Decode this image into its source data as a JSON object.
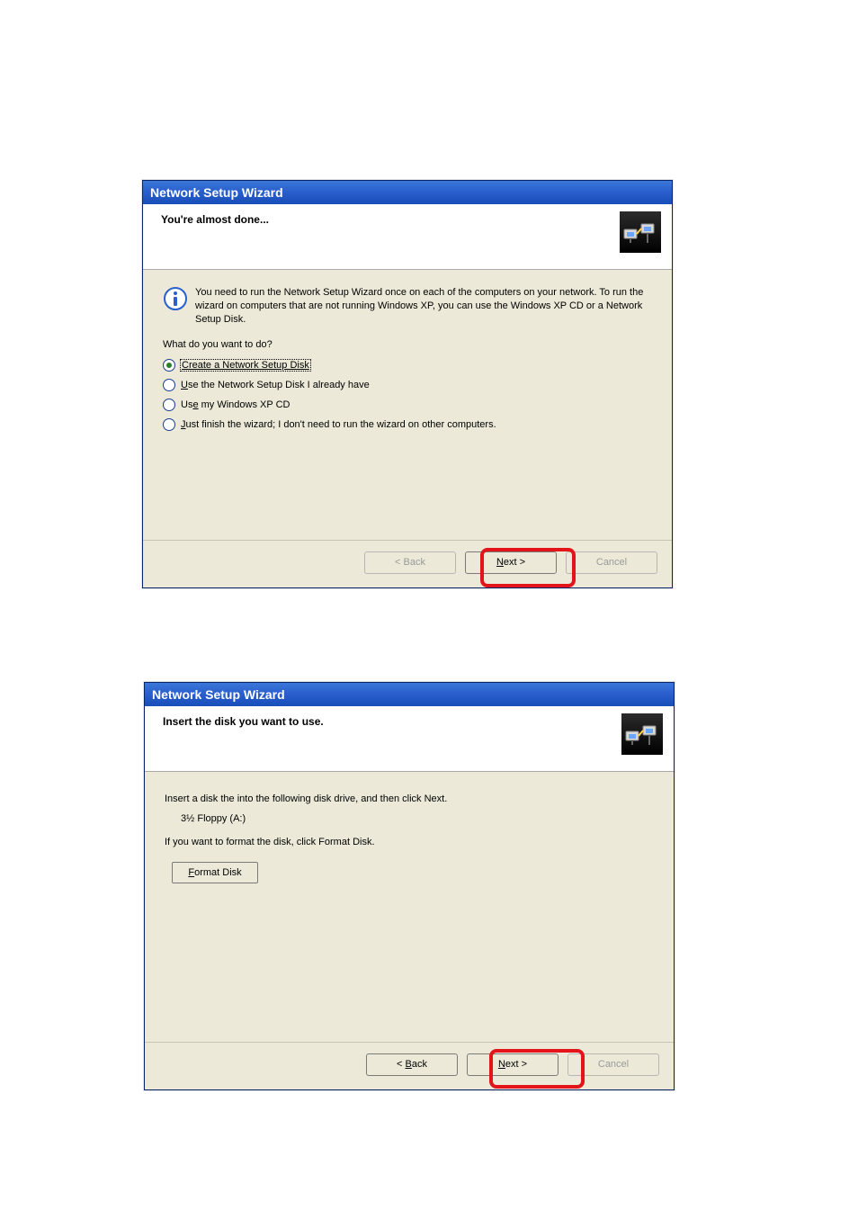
{
  "dialog1": {
    "title": "Network Setup Wizard",
    "heading": "You're almost done...",
    "info_text": "You need to run the Network Setup Wizard once on each of the computers on your network. To run the wizard on computers that are not running Windows XP, you can use the Windows XP CD or a Network Setup Disk.",
    "prompt": "What do you want to do?",
    "options": {
      "opt1_prefix": "C",
      "opt1_rest": "reate a Network Setup Disk",
      "opt2_prefix": "U",
      "opt2_rest": "se the Network Setup Disk I already have",
      "opt3_prefix": "Us",
      "opt3_underline": "e",
      "opt3_rest": " my Windows XP CD",
      "opt4_prefix": "J",
      "opt4_rest": "ust finish the wizard; I don't need to run the wizard on other computers."
    },
    "buttons": {
      "back": "< Back",
      "next_prefix": "N",
      "next_rest": "ext >",
      "cancel": "Cancel"
    }
  },
  "dialog2": {
    "title": "Network Setup Wizard",
    "heading": "Insert the disk you want to use.",
    "line1": "Insert a disk the into the following disk drive, and then click Next.",
    "drive": "3½ Floppy (A:)",
    "line2": "If you want to format the disk, click Format Disk.",
    "format_prefix": "F",
    "format_rest": "ormat Disk",
    "buttons": {
      "back_prefix": "< ",
      "back_underline": "B",
      "back_rest": "ack",
      "next_prefix": "N",
      "next_rest": "ext >",
      "cancel": "Cancel"
    }
  }
}
